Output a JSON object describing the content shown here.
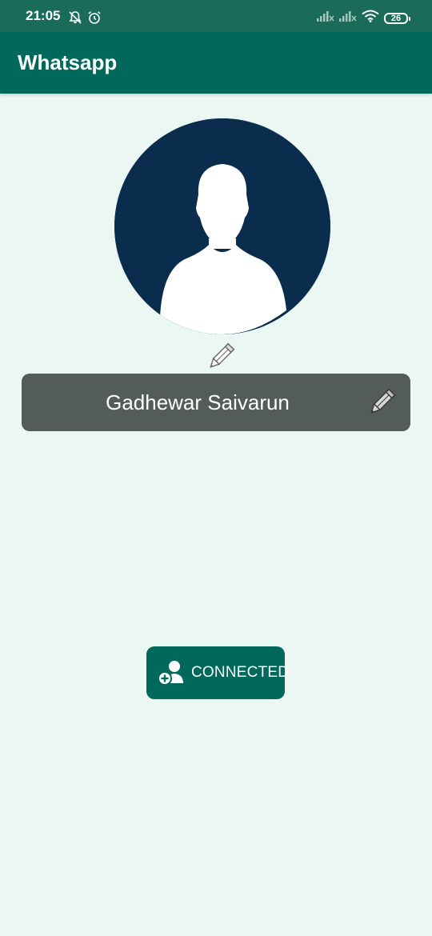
{
  "status_bar": {
    "time": "21:05",
    "battery": "26",
    "icons": [
      "mute-notification-icon",
      "alarm-icon",
      "signal-icon",
      "signal-icon",
      "wifi-icon",
      "battery-icon"
    ]
  },
  "app_bar": {
    "title": "Whatsapp"
  },
  "profile": {
    "avatar_icon": "person-silhouette-icon",
    "edit_photo_icon": "pencil-icon",
    "name": "Gadhewar Saivarun",
    "edit_name_icon": "pencil-icon"
  },
  "action": {
    "connect_label": "CONNECTED",
    "connect_icon": "add-contact-icon"
  },
  "colors": {
    "status_bar": "#1b6b5a",
    "app_bar": "#00695c",
    "background": "#eaf7f2",
    "avatar": "#0b2d4d",
    "name_bar": "#545b5b",
    "button": "#00695c"
  }
}
